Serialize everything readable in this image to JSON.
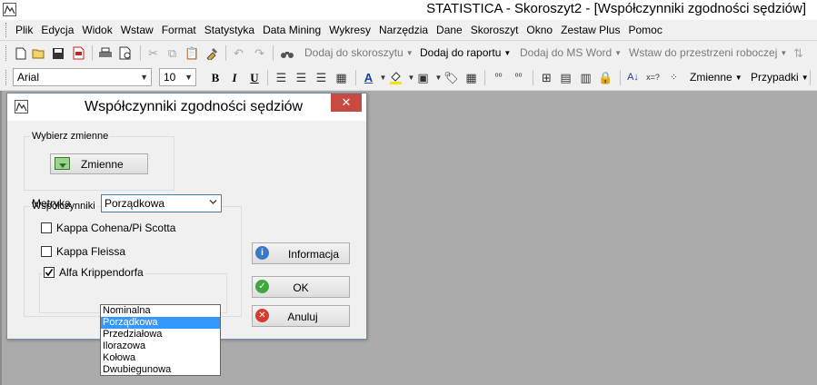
{
  "window": {
    "title": "STATISTICA - Skoroszyt2 - [Współczynniki zgodności sędziów]"
  },
  "menu": {
    "items": [
      "Plik",
      "Edycja",
      "Widok",
      "Wstaw",
      "Format",
      "Statystyka",
      "Data Mining",
      "Wykresy",
      "Narzędzia",
      "Dane",
      "Skoroszyt",
      "Okno",
      "Zestaw Plus",
      "Pomoc"
    ]
  },
  "toolbar1": {
    "add_to_workbook": "Dodaj do skoroszytu",
    "add_to_report": "Dodaj do raportu",
    "add_to_ms_word": "Dodaj do MS Word",
    "insert_to_workspace": "Wstaw do przestrzeni roboczej"
  },
  "toolbar2": {
    "font_name": "Arial",
    "font_size": "10",
    "bold": "B",
    "italic": "I",
    "underline": "U",
    "variables_menu": "Zmienne",
    "cases_menu": "Przypadki"
  },
  "dialog": {
    "title": "Współczynniki zgodności sędziów",
    "close_glyph": "✕",
    "select_vars_group": "Wybierz zmienne",
    "vars_button": "Zmienne",
    "coeffs_group": "Współczynniki",
    "coeffs": [
      {
        "label": "Kappa Cohena/Pi Scotta",
        "checked": false
      },
      {
        "label": "Kappa Fleissa",
        "checked": false
      },
      {
        "label": "Alfa Krippendorfa",
        "checked": true
      }
    ],
    "metric_label": "Metryka",
    "metric_selected": "Porządkowa",
    "metric_options": [
      "Nominalna",
      "Porządkowa",
      "Przedziałowa",
      "Ilorazowa",
      "Kołowa",
      "Dwubiegunowa"
    ],
    "info_button": "Informacja",
    "ok_button": "OK",
    "cancel_button": "Anuluj"
  },
  "colors": {
    "close_button": "#c74a42",
    "selection": "#3399ff",
    "info_icon": "#3c78c8",
    "ok_icon": "#3fa83a",
    "cancel_icon": "#d83a2e",
    "workspace": "#ababab"
  },
  "icons": {
    "info": "info-icon",
    "ok": "check-circle-icon",
    "cancel": "x-circle-icon",
    "variables": "variables-icon"
  }
}
